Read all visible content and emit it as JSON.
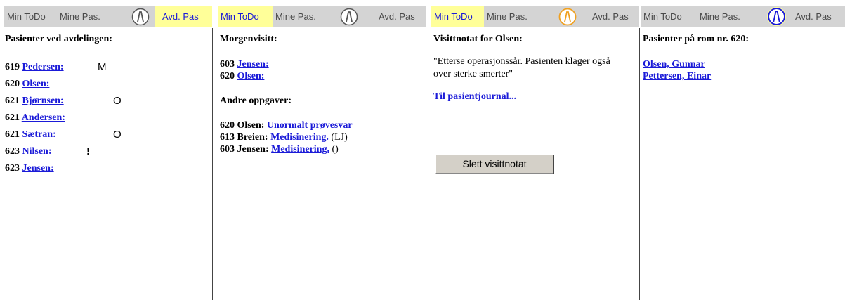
{
  "tabs": {
    "min_todo": "Min ToDo",
    "mine_pas": "Mine Pas.",
    "avd_pas": "Avd. Pas"
  },
  "colors": {
    "active_tab_bg": "#ffff99",
    "active_tab_text": "#1a1ad8",
    "link": "#1a1ad8",
    "tabbar_bg": "#d4d4d4",
    "icon_orange": "#f0a020",
    "icon_blue": "#1a1ad8",
    "icon_gray": "#555555"
  },
  "panel1": {
    "active_tab": "avd_pas",
    "heading": "Pasienter ved avdelingen:",
    "patients": [
      {
        "room": "619",
        "name": "Pedersen:",
        "mark": "M"
      },
      {
        "room": "620",
        "name": "Olsen:",
        "mark": ""
      },
      {
        "room": "621",
        "name": "Bjørnsen:",
        "mark": "O"
      },
      {
        "room": "621",
        "name": "Andersen:",
        "mark": ""
      },
      {
        "room": "621",
        "name": "Sætran:",
        "mark": "O"
      },
      {
        "room": "623",
        "name": "Nilsen:",
        "mark": "!"
      },
      {
        "room": "623",
        "name": "Jensen:",
        "mark": ""
      }
    ]
  },
  "panel2": {
    "active_tab": "min_todo",
    "heading": "Morgenvisitt:",
    "visits": [
      {
        "room": "603",
        "name": "Jensen:"
      },
      {
        "room": "620",
        "name": "Olsen:"
      }
    ],
    "other_heading": "Andre oppgaver:",
    "tasks": [
      {
        "prefix": "620 Olsen:",
        "link": "Unormalt prøvesvar",
        "suffix": ""
      },
      {
        "prefix": "613 Breien:",
        "link": "Medisinering.",
        "suffix": "(LJ)"
      },
      {
        "prefix": "603 Jensen:",
        "link": "Medisinering.",
        "suffix": "()"
      }
    ]
  },
  "panel3": {
    "active_tab": "min_todo",
    "heading": "Visittnotat for Olsen:",
    "note": "\"Etterse operasjonssår. Pasienten klager også over sterke smerter\"",
    "journal_link": "Til pasientjournal...",
    "delete_button": "Slett visittnotat"
  },
  "panel4": {
    "active_tab": "walk_icon",
    "heading": "Pasienter på rom nr. 620:",
    "patients": [
      {
        "name": "Olsen, Gunnar"
      },
      {
        "name": "Pettersen, Einar"
      }
    ]
  }
}
